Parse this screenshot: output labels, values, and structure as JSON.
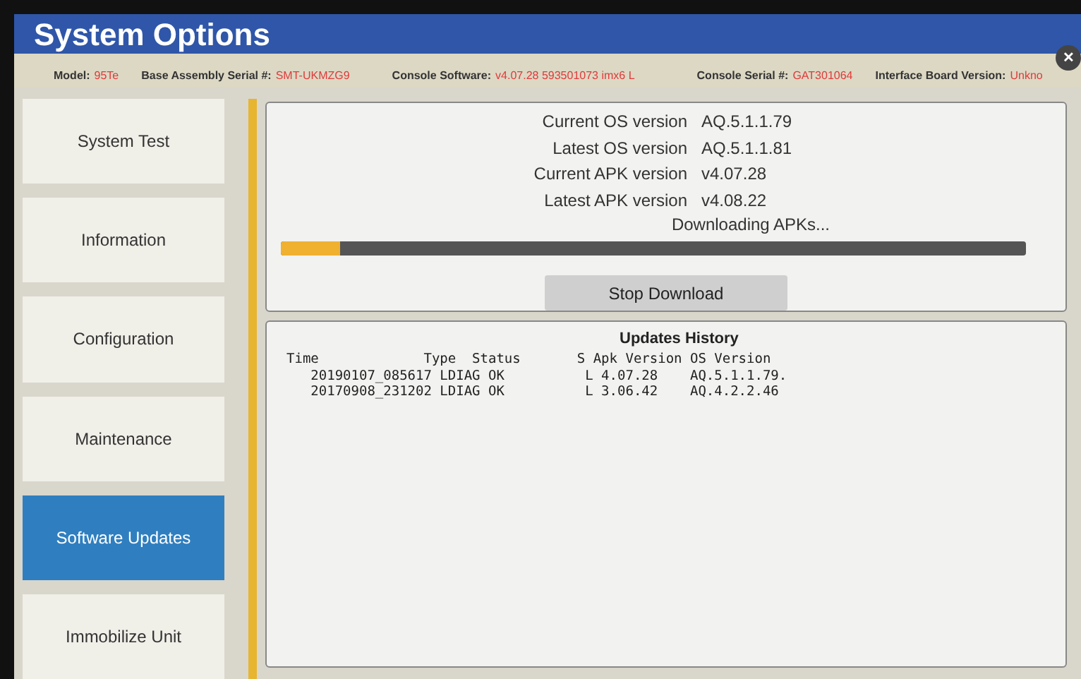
{
  "window": {
    "title": "System Options",
    "close": "✕"
  },
  "info_bar": [
    {
      "label": "Model:",
      "value": "95Te"
    },
    {
      "label": "Base Assembly Serial #:",
      "value": "SMT-UKMZG9"
    },
    {
      "label": "Console Software:",
      "value": "v4.07.28 593501073 imx6 L"
    },
    {
      "label": "Console Serial #:",
      "value": "GAT301064"
    },
    {
      "label": "Interface Board Version:",
      "value": "Unkno"
    }
  ],
  "sidebar": {
    "items": [
      {
        "label": "System Test",
        "selected": false
      },
      {
        "label": "Information",
        "selected": false
      },
      {
        "label": "Configuration",
        "selected": false
      },
      {
        "label": "Maintenance",
        "selected": false
      },
      {
        "label": "Software Updates",
        "selected": true
      },
      {
        "label": "Immobilize Unit",
        "selected": false
      }
    ]
  },
  "versions": [
    {
      "label": "Current OS version",
      "value": "AQ.5.1.1.79"
    },
    {
      "label": "Latest OS version",
      "value": "AQ.5.1.1.81"
    },
    {
      "label": "Current APK version",
      "value": "v4.07.28"
    },
    {
      "label": "Latest APK version",
      "value": "v4.08.22"
    }
  ],
  "download": {
    "status": "Downloading APKs...",
    "level": 0.08,
    "button": "Stop Download"
  },
  "history": {
    "title": "Updates History",
    "header": "Time             Type  Status       S Apk Version OS Version",
    "rows": [
      "   20190107_085617 LDIAG OK          L 4.07.28    AQ.5.1.1.79.",
      "   20170908_231202 LDIAG OK          L 3.06.42    AQ.4.2.2.46"
    ]
  }
}
